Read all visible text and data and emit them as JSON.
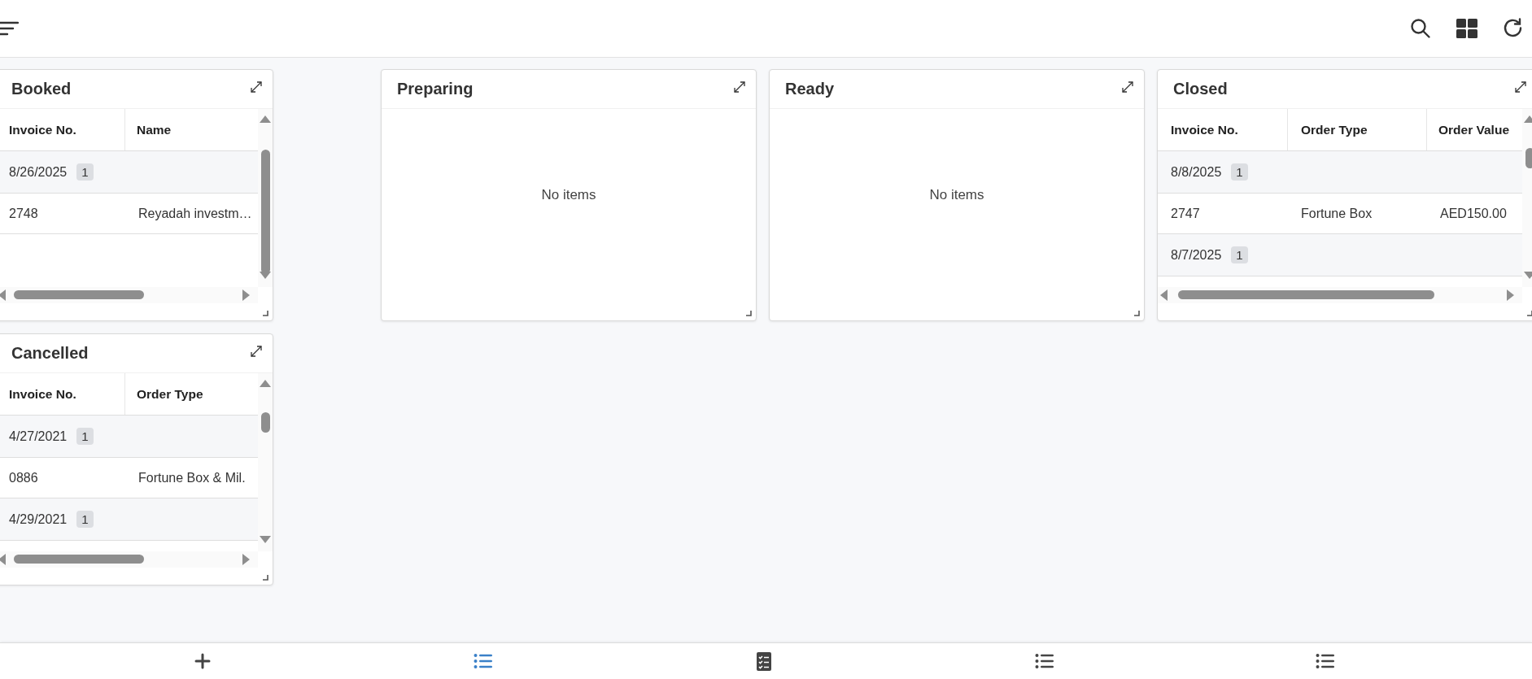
{
  "lanes": [
    {
      "panels": [
        {
          "title": "Booked",
          "kind": "table",
          "columns": [
            "Invoice No.",
            "Name"
          ],
          "rows": [
            {
              "kind": "group",
              "date": "8/26/2025",
              "count": "1"
            },
            {
              "kind": "item",
              "cells": [
                "2748",
                "Reyadah investm…"
              ]
            }
          ]
        },
        {
          "title": "Cancelled",
          "kind": "table",
          "columns": [
            "Invoice No.",
            "Order Type"
          ],
          "rows": [
            {
              "kind": "group",
              "date": "4/27/2021",
              "count": "1"
            },
            {
              "kind": "item",
              "cells": [
                "0886",
                "Fortune Box & Mil."
              ]
            },
            {
              "kind": "group",
              "date": "4/29/2021",
              "count": "1"
            }
          ]
        }
      ]
    },
    {
      "panels": [
        {
          "title": "Preparing",
          "kind": "empty",
          "message": "No items"
        }
      ]
    },
    {
      "panels": [
        {
          "title": "Ready",
          "kind": "empty",
          "message": "No items"
        }
      ]
    },
    {
      "panels": [
        {
          "title": "Closed",
          "kind": "table",
          "columns": [
            "Invoice No.",
            "Order Type",
            "Order Value"
          ],
          "rows": [
            {
              "kind": "group",
              "date": "8/8/2025",
              "count": "1"
            },
            {
              "kind": "item",
              "cells": [
                "2747",
                "Fortune Box",
                "AED150.00"
              ]
            },
            {
              "kind": "group",
              "date": "8/7/2025",
              "count": "1"
            }
          ]
        }
      ]
    }
  ],
  "bottom_nav": [
    {
      "kind": "add",
      "selected": false
    },
    {
      "kind": "list",
      "selected": true
    },
    {
      "kind": "checklist",
      "selected": false
    },
    {
      "kind": "list",
      "selected": false
    },
    {
      "kind": "list",
      "selected": false
    }
  ]
}
